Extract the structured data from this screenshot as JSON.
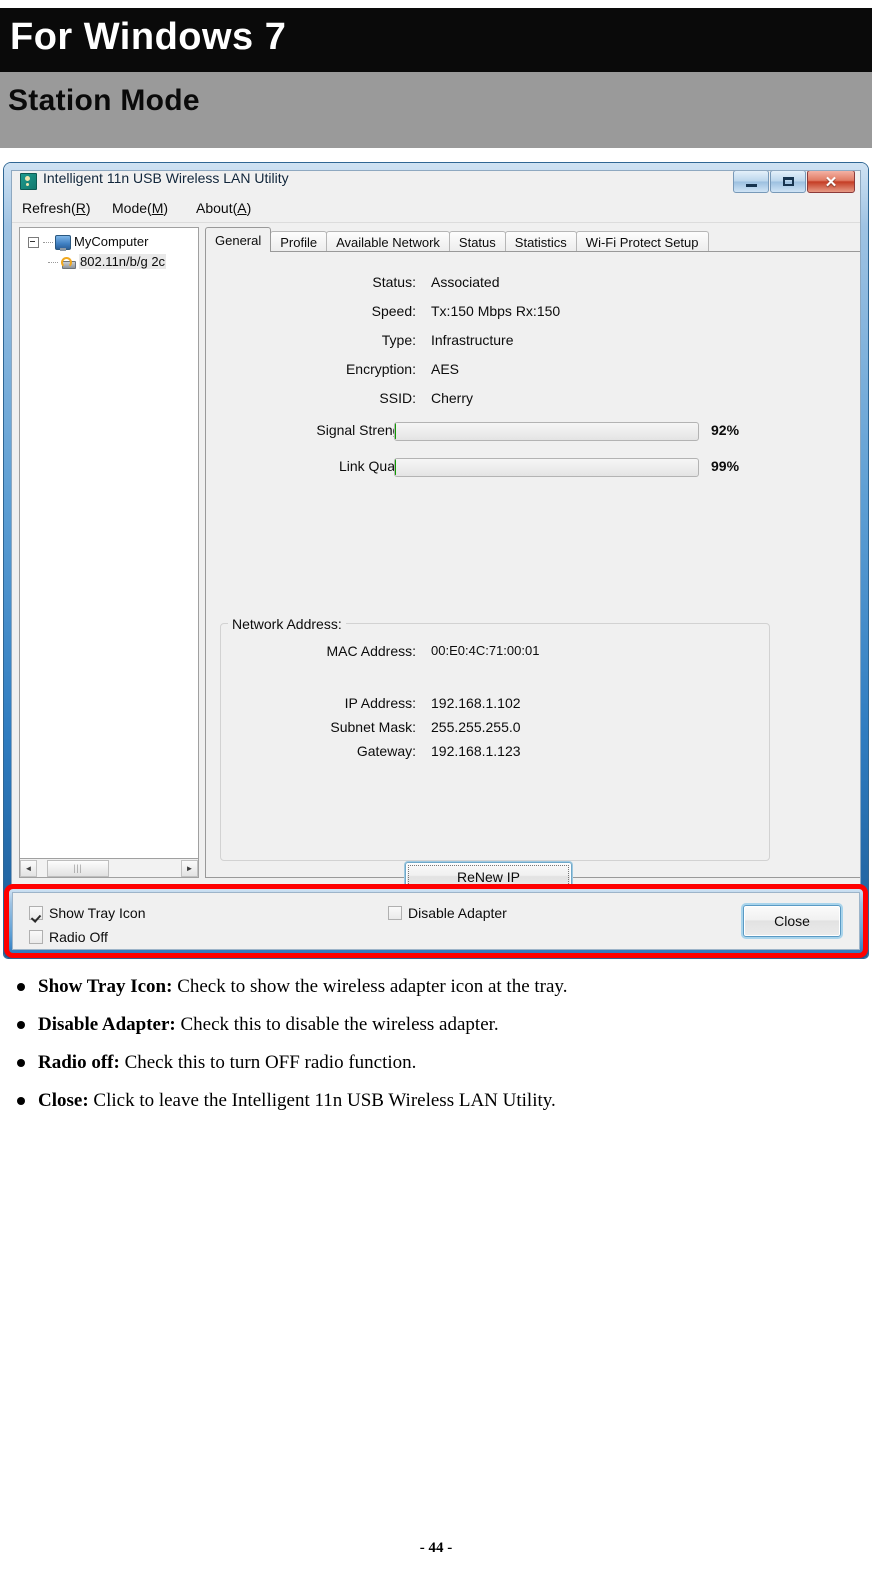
{
  "doc": {
    "header_title": "For Windows 7",
    "section_title": "Station Mode",
    "page_number": "- 44 -"
  },
  "window": {
    "title": "Intelligent 11n USB Wireless LAN Utility",
    "icon": "app-icon",
    "controls": {
      "minimize": "minimize-icon",
      "maximize": "maximize-icon",
      "close": "✕"
    }
  },
  "menu": {
    "items": [
      {
        "text": "Refresh(",
        "accel": "R",
        "tail": ")"
      },
      {
        "text": "Mode(",
        "accel": "M",
        "tail": ")"
      },
      {
        "text": "About(",
        "accel": "A",
        "tail": ")"
      }
    ]
  },
  "tree": {
    "root_label": "MyComputer",
    "child_label": "802.11n/b/g 2c",
    "scroll_left_arrow": "◄",
    "scroll_right_arrow": "►",
    "scroll_thumb_grip": "|||"
  },
  "tabs": [
    {
      "label": "General",
      "active": true
    },
    {
      "label": "Profile",
      "active": false
    },
    {
      "label": "Available Network",
      "active": false
    },
    {
      "label": "Status",
      "active": false
    },
    {
      "label": "Statistics",
      "active": false
    },
    {
      "label": "Wi-Fi Protect Setup",
      "active": false
    }
  ],
  "general": {
    "fields": [
      {
        "label": "Status:",
        "value": "Associated"
      },
      {
        "label": "Speed:",
        "value": "Tx:150 Mbps Rx:150"
      },
      {
        "label": "Type:",
        "value": "Infrastructure"
      },
      {
        "label": "Encryption:",
        "value": "AES"
      },
      {
        "label": "SSID:",
        "value": "Cherry"
      }
    ],
    "meters": [
      {
        "label": "Signal Strength:",
        "percent_text": "92%",
        "percent": 92
      },
      {
        "label": "Link Quality:",
        "percent_text": "99%",
        "percent": 99
      }
    ],
    "network_address": {
      "group_title": "Network Address:",
      "rows": [
        {
          "label": "MAC Address:",
          "value": "00:E0:4C:71:00:01"
        },
        {
          "label": "IP Address:",
          "value": "192.168.1.102"
        },
        {
          "label": "Subnet Mask:",
          "value": "255.255.255.0"
        },
        {
          "label": "Gateway:",
          "value": "192.168.1.123"
        }
      ]
    },
    "renew_button": "ReNew IP"
  },
  "bottom_bar": {
    "show_tray_icon": {
      "label": "Show Tray Icon",
      "checked": true
    },
    "radio_off": {
      "label": "Radio Off",
      "checked": false
    },
    "disable_adapter": {
      "label": "Disable Adapter",
      "checked": false
    },
    "close_button": "Close"
  },
  "bullets": [
    {
      "term": "Show Tray Icon:",
      "desc": " Check to show the wireless adapter icon at the tray."
    },
    {
      "term": "Disable Adapter:",
      "desc": " Check this to disable the wireless adapter."
    },
    {
      "term": "Radio off:",
      "desc": " Check this to turn OFF radio function."
    },
    {
      "term": "Close:",
      "desc": " Click to leave the Intelligent 11n USB Wireless LAN Utility."
    }
  ],
  "colors": {
    "accent_blue": "#2f7cc0",
    "meter_green": "#19c200",
    "highlight_red": "#ff0000",
    "header_black": "#0a0a0a",
    "header_gray": "#9a9a9a"
  }
}
